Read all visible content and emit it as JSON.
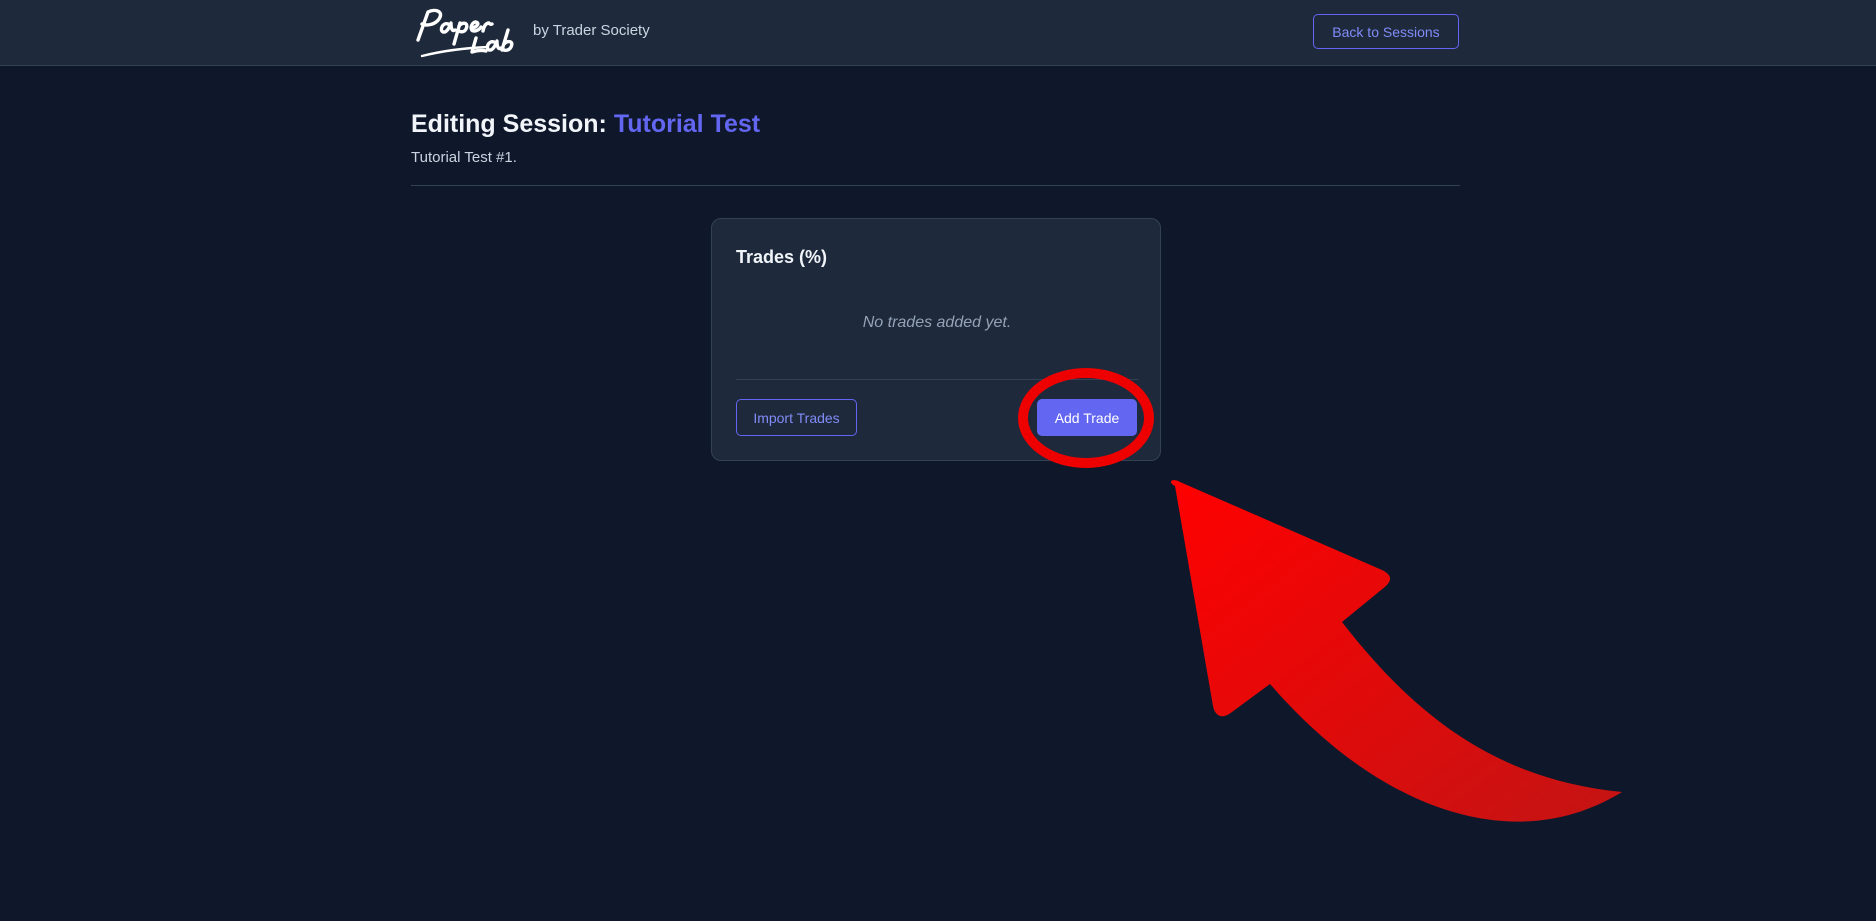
{
  "header": {
    "logo_text": "PaperLab",
    "byline": "by Trader Society",
    "back_label": "Back to Sessions"
  },
  "page": {
    "title_prefix": "Editing Session:",
    "session_name": "Tutorial Test",
    "subtitle": "Tutorial Test #1."
  },
  "trades_card": {
    "title": "Trades (%)",
    "empty_message": "No trades added yet.",
    "import_label": "Import Trades",
    "add_label": "Add Trade"
  },
  "colors": {
    "background": "#0f172a",
    "surface": "#1e293b",
    "accent": "#6366f1",
    "annotation": "#ee0000"
  },
  "annotations": {
    "highlight": "red-circle-around-add-trade",
    "pointer": "red-curved-arrow-pointing-to-add-trade"
  }
}
